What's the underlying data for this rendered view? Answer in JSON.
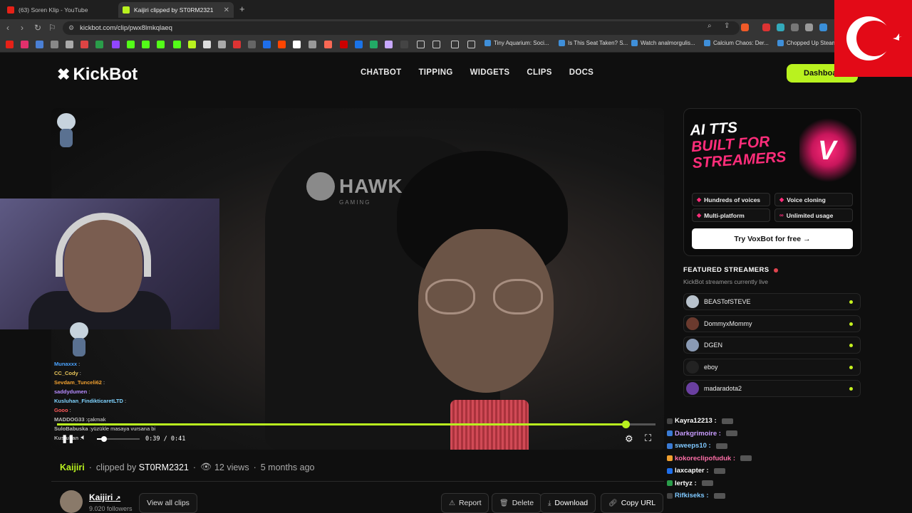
{
  "browser": {
    "tabs": [
      {
        "title": "(63) Soren Klip - YouTube",
        "favicon_color": "#e62117"
      },
      {
        "title": "Kaijiri clipped by ST0RM2321",
        "favicon_color": "#b9f21f"
      }
    ],
    "url": "kickbot.com/clip/pwx8lmkqlaeq",
    "bookmarks": [
      {
        "label": "Tiny Aquarium: Soci..."
      },
      {
        "label": "Is This Seat Taken? S..."
      },
      {
        "label": "Watch analmorgulis..."
      },
      {
        "label": "Calcium Chaos: Der..."
      },
      {
        "label": "Chopped Up Steam"
      }
    ]
  },
  "site": {
    "logo": "KickBot",
    "nav": [
      "CHATBOT",
      "TIPPING",
      "WIDGETS",
      "CLIPS",
      "DOCS"
    ],
    "dashboard_label": "Dashboard",
    "accent": "#b9f21f"
  },
  "player": {
    "brand_text": "HAWK",
    "brand_sub": "GAMING",
    "current_time": "0:39",
    "duration": "0:41",
    "progress": 0.95,
    "chat_overlay": [
      {
        "name": "Munaxxx",
        "color": "#4aa3ff",
        "msg": ""
      },
      {
        "name": "CC_Cody",
        "color": "#e8c55a",
        "msg": ""
      },
      {
        "name": "Sevdam_Tunceli62",
        "color": "#f0a030",
        "msg": ""
      },
      {
        "name": "saddydumen",
        "color": "#b78cff",
        "msg": ""
      },
      {
        "name": "Kusluhan_FindikticaretLTD",
        "color": "#7fd3ff",
        "msg": ""
      },
      {
        "name": "Gooo",
        "color": "#ff5a5a",
        "msg": ""
      },
      {
        "name": "MADDOG33",
        "color": "#bbbbbb",
        "msg": "çakmak"
      },
      {
        "name": "SuloBabuska",
        "color": "#bbbbbb",
        "msg": "yüzükle masaya vursana bi"
      },
      {
        "name": "Kusluhan",
        "color": "#bbbbbb",
        "msg": ""
      }
    ]
  },
  "clip": {
    "channel": "Kaijiri",
    "clipped_by_label": "clipped by",
    "clipper": "ST0RM2321",
    "views": "12 views",
    "age": "5 months ago",
    "followers": "9.020 followers",
    "buttons": {
      "view_all": "View all clips",
      "report": "Report",
      "delete": "Delete",
      "download": "Download",
      "copy": "Copy URL"
    }
  },
  "ad": {
    "title_line1": "AI TTS",
    "title_line2": "BUILT FOR",
    "title_line3": "STREAMERS",
    "features": [
      "Hundreds of voices",
      "Voice cloning",
      "Multi-platform",
      "Unlimited usage"
    ],
    "cta": "Try VoxBot for free →"
  },
  "featured": {
    "heading": "FEATURED STREAMERS",
    "subtitle": "KickBot streamers currently live",
    "streamers": [
      {
        "name": "BEASTofSTEVE",
        "color": "#b8c2cc"
      },
      {
        "name": "DommyxMommy",
        "color": "#6a3a2e"
      },
      {
        "name": "DGEN",
        "color": "#8a9ab4"
      },
      {
        "name": "eboy",
        "color": "#222222"
      },
      {
        "name": "madaradota2",
        "color": "#6a3fa0"
      }
    ]
  },
  "side_chat": [
    {
      "name": "Kayra12213 :",
      "color": "#ffffff"
    },
    {
      "name": "Darkgrimoire :",
      "color": "#c89cff"
    },
    {
      "name": "sweeps10 :",
      "color": "#7fc8ff"
    },
    {
      "name": "kokoreclipofuduk :",
      "color": "#ff6fa8"
    },
    {
      "name": "laxcapter :",
      "color": "#ffffff"
    },
    {
      "name": "lertyz :",
      "color": "#ffffff"
    },
    {
      "name": "Rifkiseks :",
      "color": "#7fc8ff"
    }
  ]
}
